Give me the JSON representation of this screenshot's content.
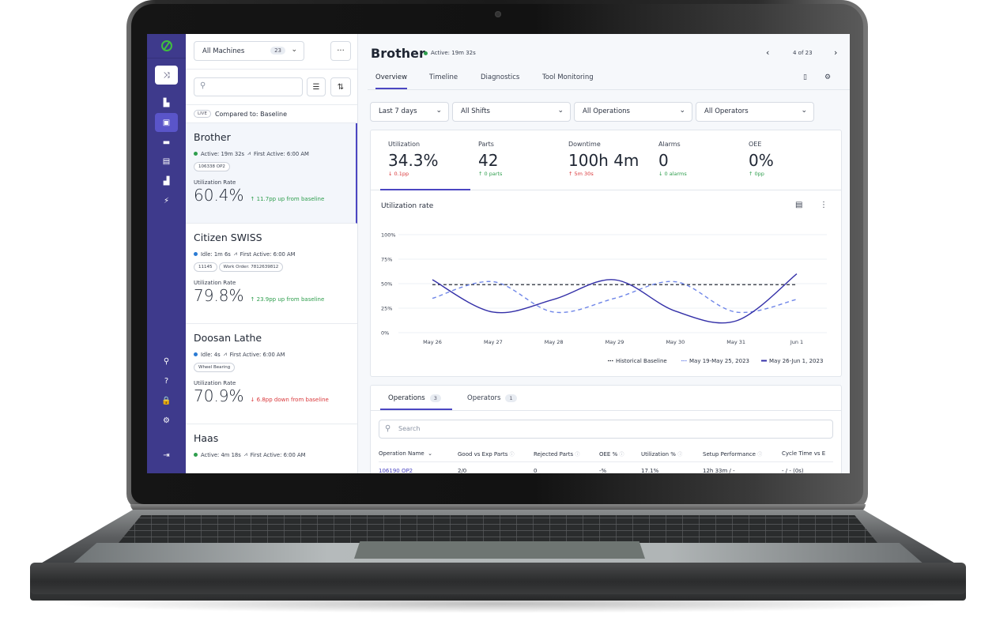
{
  "app": {
    "colors": {
      "accent": "#4b46c2",
      "rail": "#3e3a8c",
      "up": "#2e9e4d",
      "down": "#d9373a",
      "logo": "#3fbf3f"
    }
  },
  "rail": {
    "items": [
      {
        "icon": "shuffle-icon",
        "glyph": "⤨"
      },
      {
        "icon": "factory-icon",
        "glyph": "▙"
      },
      {
        "icon": "machine-icon",
        "glyph": "▣"
      },
      {
        "icon": "calendar-icon",
        "glyph": "▬"
      },
      {
        "icon": "report-icon",
        "glyph": "▤"
      },
      {
        "icon": "bar-chart-icon",
        "glyph": "▟"
      },
      {
        "icon": "lightning-icon",
        "glyph": "⚡"
      },
      {
        "icon": "search-icon",
        "glyph": "⚲"
      },
      {
        "icon": "help-icon",
        "glyph": "?"
      },
      {
        "icon": "lock-icon",
        "glyph": "🔒"
      },
      {
        "icon": "settings-icon",
        "glyph": "⚙"
      },
      {
        "icon": "logout-icon",
        "glyph": "⇥"
      }
    ]
  },
  "list": {
    "machine_select": {
      "label": "All Machines",
      "count": "23"
    },
    "more_glyph": "···",
    "search_placeholder": "",
    "live_label": "LIVE",
    "compared_to": "Compared to: Baseline",
    "machines": [
      {
        "name": "Brother",
        "status": "Active: 19m 32s",
        "status_color": "#2e9e4d",
        "first_active": "First Active: 6:00 AM",
        "tags": [
          "106338 OP2"
        ],
        "util_label": "Utilization Rate",
        "util": "60.4%",
        "delta": "↑ 11.7pp up from baseline",
        "delta_dir": "up"
      },
      {
        "name": "Citizen SWISS",
        "status": "Idle: 1m 6s",
        "status_color": "#2a7bd4",
        "first_active": "First Active: 6:00 AM",
        "tags": [
          "11145",
          "Work Order: 7812639812"
        ],
        "util_label": "Utilization Rate",
        "util": "79.8%",
        "delta": "↑ 23.9pp up from baseline",
        "delta_dir": "up"
      },
      {
        "name": "Doosan Lathe",
        "status": "Idle: 4s",
        "status_color": "#2a7bd4",
        "first_active": "First Active: 6:00 AM",
        "tags": [
          "Wheel Bearing"
        ],
        "util_label": "Utilization Rate",
        "util": "70.9%",
        "delta": "↓ 6.8pp down from baseline",
        "delta_dir": "down"
      },
      {
        "name": "Haas",
        "status": "Active: 4m 18s",
        "status_color": "#2e9e4d",
        "first_active": "First Active: 6:00 AM",
        "tags": [],
        "util_label": "",
        "util": "",
        "delta": "",
        "delta_dir": "up"
      }
    ]
  },
  "header": {
    "title": "Brother",
    "status": "Active: 19m 32s",
    "pager": "4 of 23",
    "tabs": [
      "Overview",
      "Timeline",
      "Diagnostics",
      "Tool Monitoring"
    ]
  },
  "filters": [
    "Last 7 days",
    "All Shifts",
    "All Operations",
    "All Operators"
  ],
  "kpis": [
    {
      "label": "Utilization",
      "value": "34.3%",
      "change": "↓ 0.1pp",
      "dir": "down"
    },
    {
      "label": "Parts",
      "value": "42",
      "change": "↑ 0 parts",
      "dir": "up"
    },
    {
      "label": "Downtime",
      "value": "100h 4m",
      "change": "↑ 5m 30s",
      "dir": "down"
    },
    {
      "label": "Alarms",
      "value": "0",
      "change": "↓ 0 alarms",
      "dir": "up"
    },
    {
      "label": "OEE",
      "value": "0%",
      "change": "↑ 0pp",
      "dir": "up"
    }
  ],
  "chart_data": {
    "type": "line",
    "title": "Utilization rate",
    "xlabel": "",
    "ylabel": "",
    "categories": [
      "May 26",
      "May 27",
      "May 28",
      "May 29",
      "May 30",
      "May 31",
      "Jun 1"
    ],
    "yticks": [
      "0%",
      "25%",
      "50%",
      "75%",
      "100%"
    ],
    "ylim": [
      0,
      100
    ],
    "grid": true,
    "legend_position": "bottom-right",
    "series": [
      {
        "name": "Historical Baseline",
        "style": "dashed",
        "color": "#2a2f3a",
        "values": [
          49,
          49,
          49,
          49,
          49,
          49,
          49
        ]
      },
      {
        "name": "May 19-May 25, 2023",
        "style": "dashed",
        "color": "#6f86e8",
        "values": [
          35,
          52,
          21,
          35,
          52,
          21,
          34
        ]
      },
      {
        "name": "May 26-Jun 1, 2023",
        "style": "solid",
        "color": "#3430a8",
        "values": [
          54,
          21,
          34,
          54,
          22,
          12,
          60
        ]
      }
    ]
  },
  "operations": {
    "tabs": [
      {
        "label": "Operations",
        "count": "3"
      },
      {
        "label": "Operators",
        "count": "1"
      }
    ],
    "search_placeholder": "Search",
    "columns": [
      "Operation Name",
      "Good vs Exp Parts",
      "Rejected Parts",
      "OEE %",
      "Utilization %",
      "Setup Performance",
      "Cycle Time vs E"
    ],
    "rows": [
      [
        "106190 OP2",
        "2/0",
        "0",
        "-%",
        "17.1%",
        "12h 33m / -",
        "- / - (0s)"
      ]
    ]
  }
}
